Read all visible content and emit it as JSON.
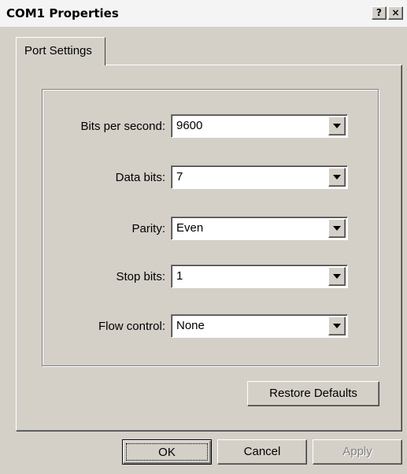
{
  "window": {
    "title": "COM1 Properties",
    "help_label": "?",
    "close_label": "×"
  },
  "tabs": [
    {
      "label": "Port Settings",
      "active": true
    }
  ],
  "settings": [
    {
      "label": "Bits per second:",
      "value": "9600"
    },
    {
      "label": "Data bits:",
      "value": "7"
    },
    {
      "label": "Parity:",
      "value": "Even"
    },
    {
      "label": "Stop bits:",
      "value": "1"
    },
    {
      "label": "Flow control:",
      "value": "None"
    }
  ],
  "buttons": {
    "restore_defaults": "Restore Defaults",
    "ok": "OK",
    "cancel": "Cancel",
    "apply": "Apply"
  },
  "icons": {
    "dropdown": "chevron-down-icon"
  }
}
